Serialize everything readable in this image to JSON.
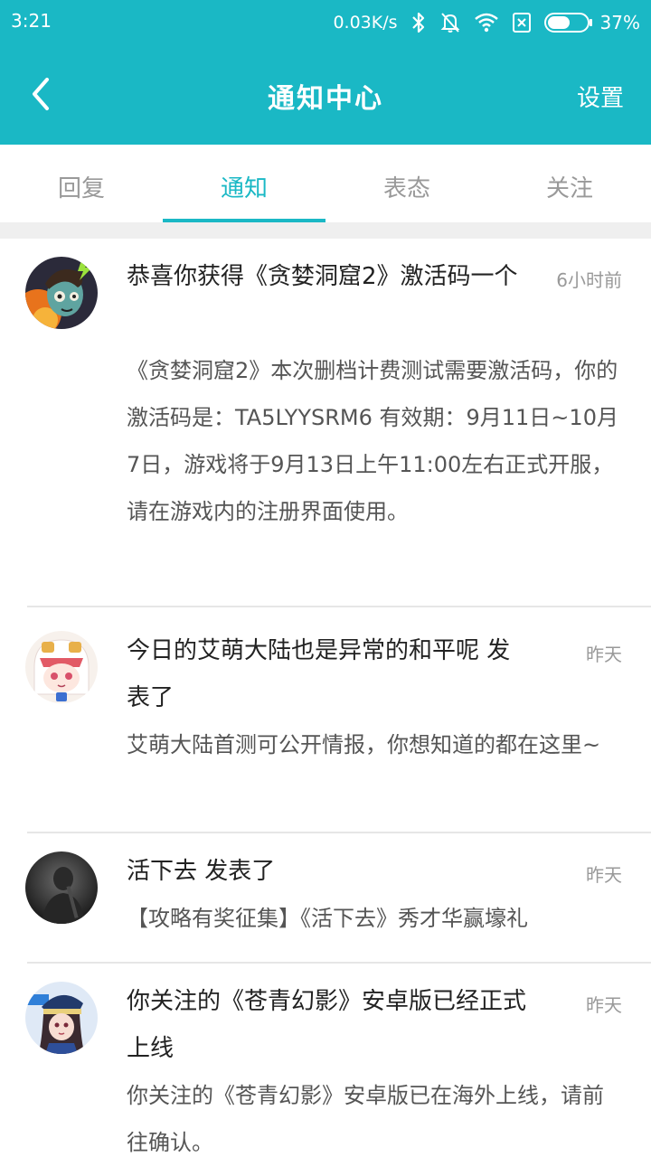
{
  "status_bar": {
    "time": "3:21",
    "network_speed": "0.03K/s",
    "battery": "37%",
    "icons": [
      "bluetooth-icon",
      "mute-icon",
      "wifi-icon",
      "sim-off-icon",
      "battery-icon"
    ]
  },
  "header": {
    "title": "通知中心",
    "settings_label": "设置",
    "background_color": "#1ab8c5"
  },
  "tabs": [
    {
      "label": "回复",
      "active": false
    },
    {
      "label": "通知",
      "active": true
    },
    {
      "label": "表态",
      "active": false
    },
    {
      "label": "关注",
      "active": false
    }
  ],
  "notifications": [
    {
      "title": "恭喜你获得《贪婪洞窟2》激活码一个",
      "time": "6小时前",
      "body": "《贪婪洞窟2》本次删档计费测试需要激活码，你的激活码是：TA5LYYSRM6 有效期：9月11日~10月7日，游戏将于9月13日上午11:00左右正式开服，请在游戏内的注册界面使用。"
    },
    {
      "title": "今日的艾萌大陆也是异常的和平呢 发表了",
      "time": "昨天",
      "body": "艾萌大陆首测可公开情报，你想知道的都在这里~"
    },
    {
      "title": "活下去 发表了",
      "time": "昨天",
      "body": "【攻略有奖征集】《活下去》秀才华赢壕礼"
    },
    {
      "title": "你关注的《苍青幻影》安卓版已经正式上线",
      "time": "昨天",
      "body": "你关注的《苍青幻影》安卓版已在海外上线，请前往确认。"
    }
  ]
}
